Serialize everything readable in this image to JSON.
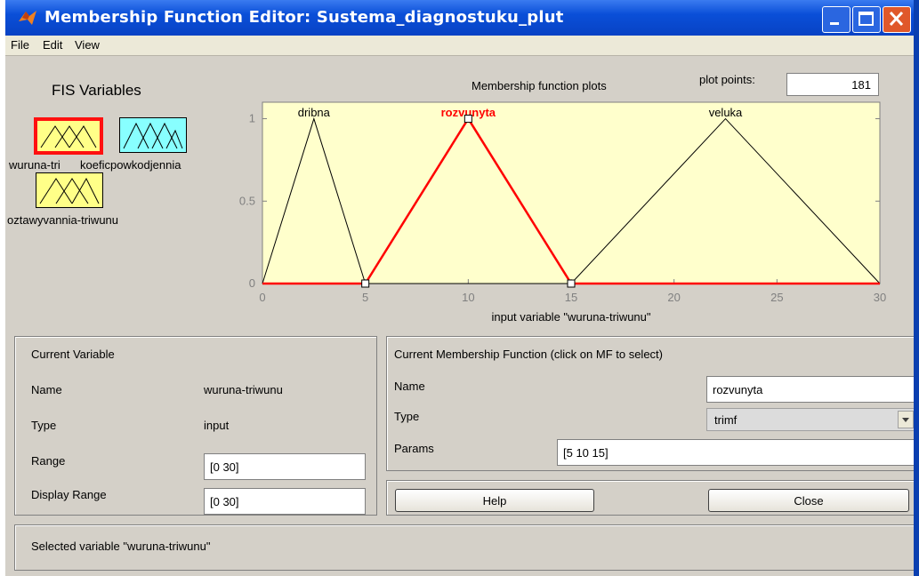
{
  "window": {
    "title": "Membership Function Editor: Sustema_diagnostuku_plut"
  },
  "menu": {
    "items": [
      "File",
      "Edit",
      "View"
    ]
  },
  "fis": {
    "heading": "FIS Variables",
    "variables": [
      {
        "label": "wuruna-triwunu",
        "color": "#ffff88",
        "selected": true
      },
      {
        "label": "koeficpowkodjennia",
        "color": "#88ffff",
        "selected": false
      },
      {
        "label": "roztawyvannia-triwunu",
        "color": "#ffff88",
        "selected": false
      }
    ],
    "overlap_label_a": "wuruna-tri",
    "overlap_label_b": "koeficpowkodjennia",
    "third_label": "oztawyvannia-triwunu"
  },
  "plot": {
    "title": "Membership function plots",
    "plot_points_label": "plot points:",
    "plot_points_value": "181",
    "xlabel": "input variable \"wuruna-triwunu\"",
    "xticks": [
      "0",
      "5",
      "10",
      "15",
      "20",
      "25",
      "30"
    ],
    "yticks": [
      "0",
      "0.5",
      "1"
    ]
  },
  "chart_data": {
    "type": "line",
    "title": "",
    "xlabel": "input variable \"wuruna-triwunu\"",
    "ylabel": "",
    "xlim": [
      0,
      30
    ],
    "ylim": [
      0,
      1.1
    ],
    "background": "#ffffcc",
    "selected_color": "#ff0000",
    "series": [
      {
        "name": "dribna",
        "x": [
          0,
          2.5,
          5,
          30
        ],
        "y": [
          0,
          1,
          0,
          0
        ],
        "selected": false
      },
      {
        "name": "rozvunyta",
        "x": [
          0,
          5,
          10,
          15,
          30
        ],
        "y": [
          0,
          0,
          1,
          0,
          0
        ],
        "selected": true
      },
      {
        "name": "veluka",
        "x": [
          0,
          15,
          22.5,
          30
        ],
        "y": [
          0,
          0,
          1,
          0
        ],
        "selected": false
      }
    ]
  },
  "current_variable": {
    "heading": "Current Variable",
    "name_label": "Name",
    "name_value": "wuruna-triwunu",
    "type_label": "Type",
    "type_value": "input",
    "range_label": "Range",
    "range_value": "[0 30]",
    "display_range_label": "Display Range",
    "display_range_value": "[0 30]"
  },
  "current_mf": {
    "heading": "Current Membership Function (click on MF to select)",
    "name_label": "Name",
    "name_value": "rozvunyta",
    "type_label": "Type",
    "type_value": "trimf",
    "params_label": "Params",
    "params_value": "[5 10 15]"
  },
  "buttons": {
    "help": "Help",
    "close": "Close"
  },
  "status": {
    "text": "Selected variable \"wuruna-triwunu\""
  }
}
